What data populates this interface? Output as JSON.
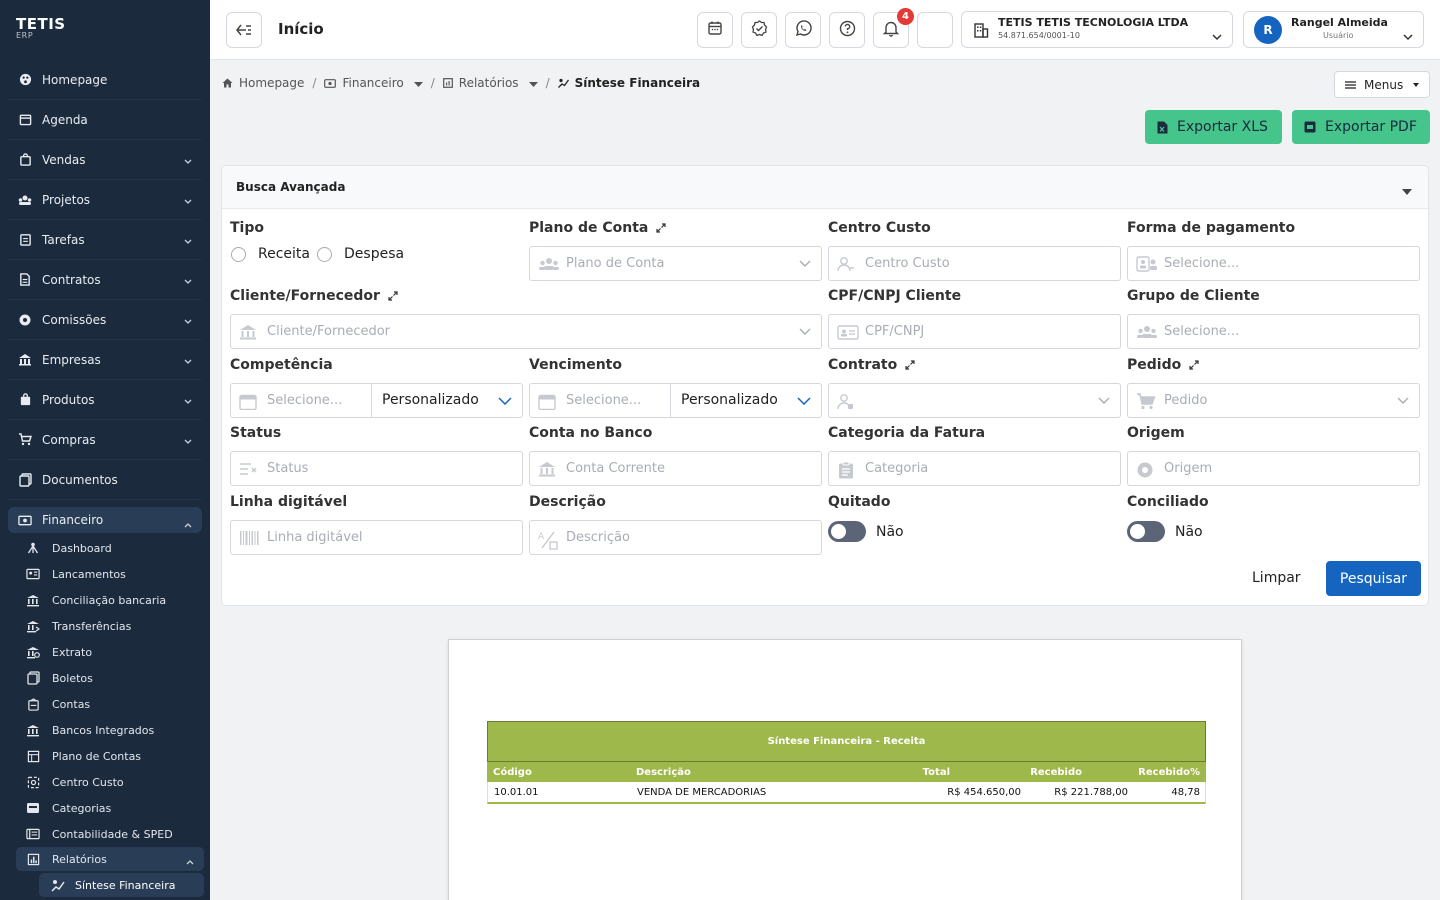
{
  "brand": {
    "name": "TETIS",
    "sub": "ERP"
  },
  "sidebar": {
    "items": [
      {
        "label": "Homepage",
        "icon": "palette-icon"
      },
      {
        "label": "Agenda",
        "icon": "calendar-icon"
      },
      {
        "label": "Vendas",
        "icon": "bag-icon"
      },
      {
        "label": "Projetos",
        "icon": "projects-icon"
      },
      {
        "label": "Tarefas",
        "icon": "clipboard-icon"
      },
      {
        "label": "Contratos",
        "icon": "document-icon"
      },
      {
        "label": "Comissões",
        "icon": "gear-icon"
      },
      {
        "label": "Empresas",
        "icon": "building-icon"
      },
      {
        "label": "Produtos",
        "icon": "box-icon"
      },
      {
        "label": "Compras",
        "icon": "cart-icon"
      },
      {
        "label": "Documentos",
        "icon": "files-icon"
      }
    ],
    "active": {
      "label": "Financeiro",
      "icon": "money-icon"
    },
    "sub_items": [
      {
        "label": "Dashboard"
      },
      {
        "label": "Lancamentos"
      },
      {
        "label": "Conciliação bancaria"
      },
      {
        "label": "Transferências"
      },
      {
        "label": "Extrato"
      },
      {
        "label": "Boletos"
      },
      {
        "label": "Contas"
      },
      {
        "label": "Bancos Integrados"
      },
      {
        "label": "Plano de Contas"
      },
      {
        "label": "Centro Custo"
      },
      {
        "label": "Categorias"
      },
      {
        "label": "Contabilidade & SPED"
      }
    ],
    "reports": {
      "label": "Relatórios"
    },
    "current": {
      "label": "Síntese Financeira"
    }
  },
  "header": {
    "title": "Início",
    "notifications": "4",
    "company_name": "TETIS TETIS TECNOLOGIA LTDA",
    "company_cnpj": "54.871.654/0001-10",
    "user_initial": "R",
    "user_name": "Rangel Almeida",
    "user_role": "Usuário"
  },
  "breadcrumb": {
    "home": "Homepage",
    "financeiro": "Financeiro",
    "relatorios": "Relatórios",
    "current": "Síntese Financeira"
  },
  "menus_label": "Menus",
  "export": {
    "xls": "Exportar XLS",
    "pdf": "Exportar PDF"
  },
  "search": {
    "title": "Busca Avançada",
    "tipo": {
      "label": "Tipo",
      "receita": "Receita",
      "despesa": "Despesa"
    },
    "plano_conta": {
      "label": "Plano de Conta",
      "placeholder": "Plano de Conta"
    },
    "centro_custo": {
      "label": "Centro Custo",
      "placeholder": "Centro Custo"
    },
    "forma_pagamento": {
      "label": "Forma de pagamento",
      "placeholder": "Selecione..."
    },
    "cliente": {
      "label": "Cliente/Fornecedor",
      "placeholder": "Cliente/Fornecedor"
    },
    "cpf": {
      "label": "CPF/CNPJ Cliente",
      "placeholder": "CPF/CNPJ"
    },
    "grupo": {
      "label": "Grupo de Cliente",
      "placeholder": "Selecione..."
    },
    "competencia": {
      "label": "Competência",
      "placeholder": "Selecione...",
      "mode": "Personalizado"
    },
    "vencimento": {
      "label": "Vencimento",
      "placeholder": "Selecione...",
      "mode": "Personalizado"
    },
    "contrato": {
      "label": "Contrato",
      "placeholder": ""
    },
    "pedido": {
      "label": "Pedido",
      "placeholder": "Pedido"
    },
    "status": {
      "label": "Status",
      "placeholder": "Status"
    },
    "conta_banco": {
      "label": "Conta no Banco",
      "placeholder": "Conta Corrente"
    },
    "categoria": {
      "label": "Categoria da Fatura",
      "placeholder": "Categoria"
    },
    "origem": {
      "label": "Origem",
      "placeholder": "Origem"
    },
    "linha": {
      "label": "Linha digitável",
      "placeholder": "Linha digitável"
    },
    "descricao": {
      "label": "Descrição",
      "placeholder": "Descrição"
    },
    "quitado": {
      "label": "Quitado",
      "value": "Não"
    },
    "conciliado": {
      "label": "Conciliado",
      "value": "Não"
    },
    "clear": "Limpar",
    "submit": "Pesquisar"
  },
  "report": {
    "title": "Síntese Financeira - Receita",
    "columns": [
      "Código",
      "Descrição",
      "Total",
      "Recebido",
      "Recebido%"
    ],
    "rows": [
      [
        "10.01.01",
        "VENDA DE MERCADORIAS",
        "R$ 454.650,00",
        "R$ 221.788,00",
        "48,78"
      ]
    ]
  },
  "colors": {
    "sidebar": "#1b2a3d",
    "primary": "#1565c0",
    "export": "#45c58b",
    "report_header": "#9fb84c"
  }
}
